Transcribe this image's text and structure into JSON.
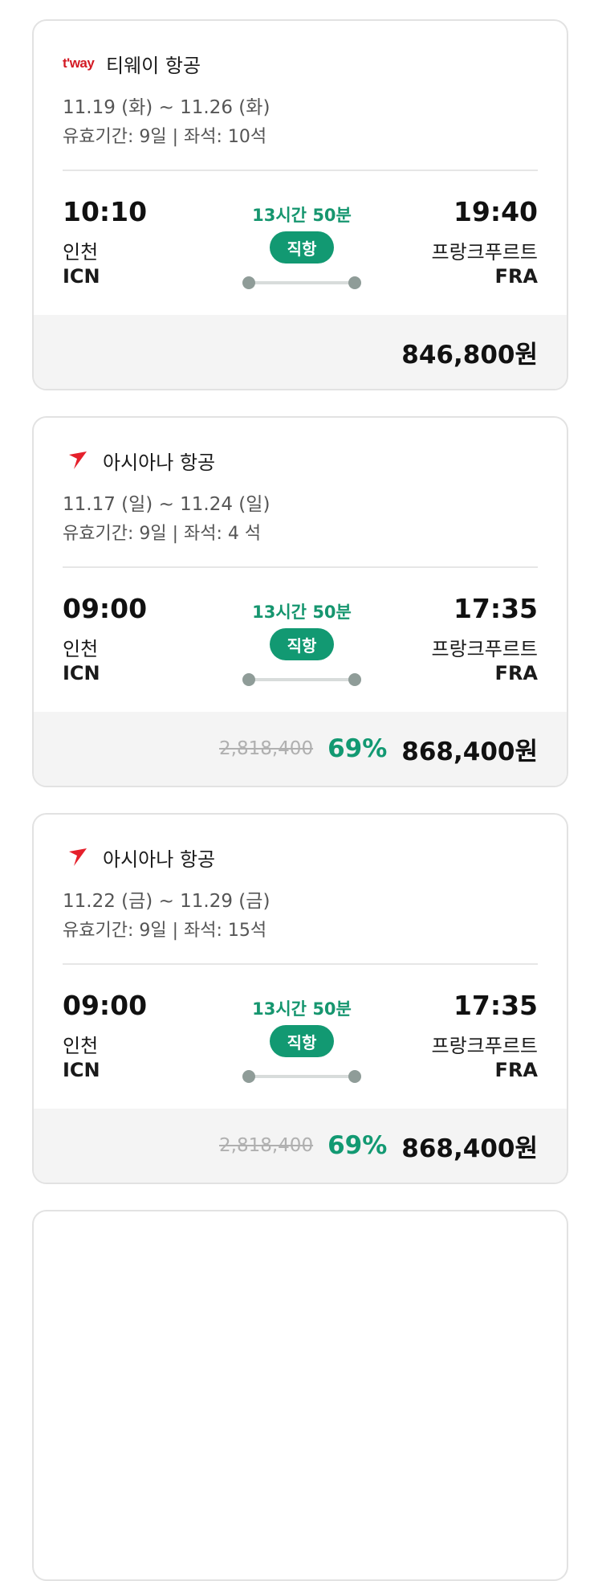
{
  "cards": [
    {
      "airline_logo": "t'way",
      "airline_logo_icon": "tway-logo-icon",
      "airline_name": "티웨이 항공",
      "dates": "11.19 (화) ~ 11.26 (화)",
      "validity": "유효기간: 9일 | 좌석: 10석",
      "departure": {
        "time": "10:10",
        "city": "인천",
        "code": "ICN"
      },
      "arrival": {
        "time": "19:40",
        "city": "프랑크푸르트",
        "code": "FRA"
      },
      "duration": "13시간 50분",
      "badge": "직항",
      "original_price": "",
      "discount": "",
      "price": "846,800원"
    },
    {
      "airline_logo_icon": "asiana-logo-icon",
      "airline_logo_color": "#e5202b",
      "airline_name": "아시아나 항공",
      "dates": "11.17 (일) ~ 11.24 (일)",
      "validity": "유효기간: 9일 | 좌석: 4 석",
      "departure": {
        "time": "09:00",
        "city": "인천",
        "code": "ICN"
      },
      "arrival": {
        "time": "17:35",
        "city": "프랑크푸르트",
        "code": "FRA"
      },
      "duration": "13시간 50분",
      "badge": "직항",
      "original_price": "2,818,400",
      "discount": "69%",
      "price": "868,400원"
    },
    {
      "airline_logo_icon": "asiana-logo-icon",
      "airline_logo_color": "#e5202b",
      "airline_name": "아시아나 항공",
      "dates": "11.22 (금) ~ 11.29 (금)",
      "validity": "유효기간: 9일 | 좌석: 15석",
      "departure": {
        "time": "09:00",
        "city": "인천",
        "code": "ICN"
      },
      "arrival": {
        "time": "17:35",
        "city": "프랑크푸르트",
        "code": "FRA"
      },
      "duration": "13시간 50분",
      "badge": "직항",
      "original_price": "2,818,400",
      "discount": "69%",
      "price": "868,400원"
    }
  ],
  "colors": {
    "accent_green": "#129972",
    "duration_green": "#16966f",
    "tway_red": "#d31a24",
    "asiana_red": "#e5202b",
    "route_dot": "#8f9c98",
    "price_bg": "#f4f4f4"
  }
}
